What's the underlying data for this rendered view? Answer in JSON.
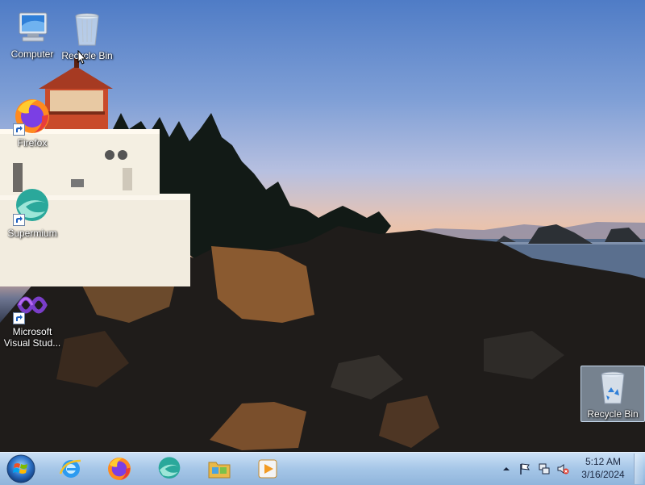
{
  "desktop": {
    "icons": [
      {
        "label": "Computer",
        "icon": "computer-icon"
      },
      {
        "label": "Recycle Bin",
        "icon": "recycle-bin-icon"
      },
      {
        "label": "Firefox",
        "icon": "firefox-icon"
      },
      {
        "label": "Supermium",
        "icon": "supermium-icon"
      },
      {
        "label": "Microsoft Visual Stud...",
        "icon": "visual-studio-icon"
      },
      {
        "label": "Recycle Bin",
        "icon": "recycle-bin-icon"
      }
    ]
  },
  "taskbar": {
    "pinned": [
      {
        "name": "Internet Explorer",
        "icon": "internet-explorer-icon"
      },
      {
        "name": "Firefox",
        "icon": "firefox-icon"
      },
      {
        "name": "Supermium",
        "icon": "supermium-icon"
      },
      {
        "name": "Windows Explorer",
        "icon": "folder-icon"
      },
      {
        "name": "Media Player",
        "icon": "media-player-icon"
      }
    ],
    "tray": {
      "time": "5:12 AM",
      "date": "3/16/2024"
    }
  },
  "colors": {
    "taskbar": "#a8c6e6",
    "selection": "#bed7f0"
  }
}
